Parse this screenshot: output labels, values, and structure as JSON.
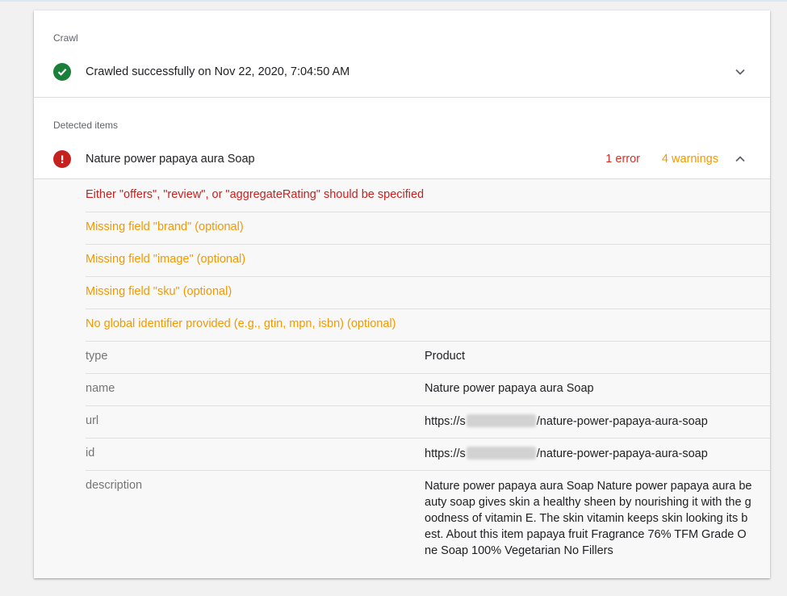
{
  "crawl": {
    "section_title": "Crawl",
    "status_text": "Crawled successfully on Nov 22, 2020, 7:04:50 AM"
  },
  "detected": {
    "section_title": "Detected items",
    "item_name": "Nature power papaya aura Soap",
    "error_count": "1 error",
    "warning_count": "4 warnings"
  },
  "issues": [
    {
      "type": "error",
      "text": "Either \"offers\", \"review\", or \"aggregateRating\" should be specified"
    },
    {
      "type": "warning",
      "text": "Missing field \"brand\" (optional)"
    },
    {
      "type": "warning",
      "text": "Missing field \"image\" (optional)"
    },
    {
      "type": "warning",
      "text": "Missing field \"sku\" (optional)"
    },
    {
      "type": "warning",
      "text": "No global identifier provided (e.g., gtin, mpn, isbn) (optional)"
    }
  ],
  "properties": [
    {
      "key": "type",
      "value": "Product"
    },
    {
      "key": "name",
      "value": "Nature power papaya aura Soap"
    },
    {
      "key": "url",
      "value_prefix": "https://s",
      "value_suffix": "/nature-power-papaya-aura-soap"
    },
    {
      "key": "id",
      "value_prefix": "https://s",
      "value_suffix": "/nature-power-papaya-aura-soap"
    },
    {
      "key": "description",
      "value": "Nature power papaya aura Soap Nature power papaya aura beauty soap gives skin a healthy sheen by nourishing it with the goodness of vitamin E. The skin vitamin keeps skin looking its best. About this item papaya fruit Fragrance 76% TFM Grade One Soap 100% Vegetarian No Fillers"
    }
  ],
  "icons": {
    "crawl_status": "check-circle-icon",
    "item_status": "error-icon",
    "crawl_toggle": "chevron-down-icon",
    "item_toggle": "chevron-up-icon"
  },
  "colors": {
    "success": "#188038",
    "error": "#c5221f",
    "warning": "#f29900"
  }
}
